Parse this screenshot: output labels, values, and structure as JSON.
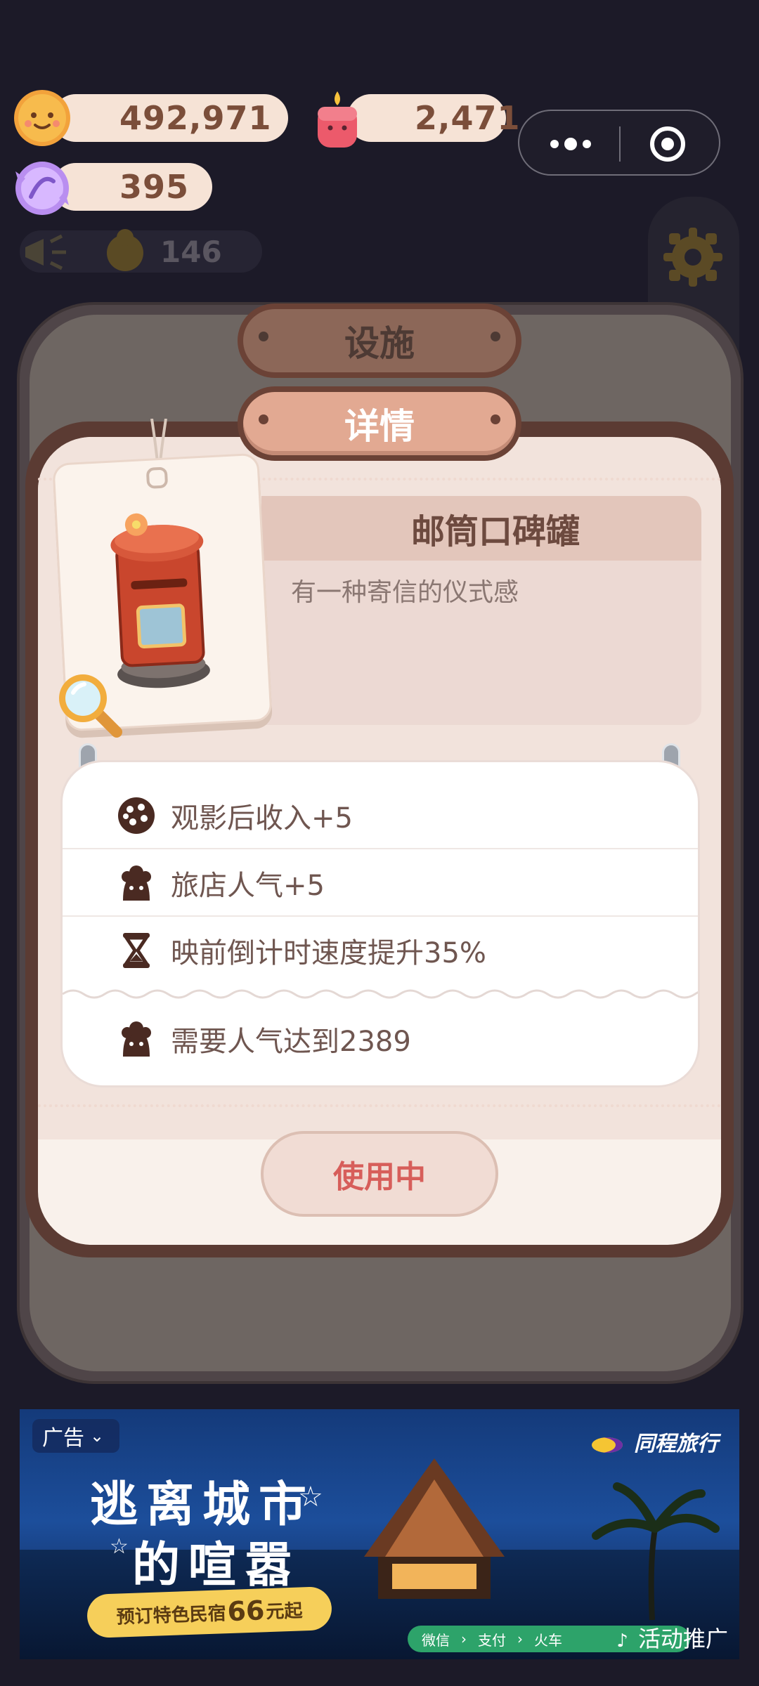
{
  "resources": {
    "cookies": "492,971",
    "candles": "2,471",
    "candy": "395",
    "secondary_count": "146"
  },
  "panel": {
    "facilities_title": "设施",
    "details_title": "详情"
  },
  "item": {
    "name": "邮筒口碑罐",
    "description": "有一种寄信的仪式感"
  },
  "stats": [
    {
      "icon": "cookie-icon",
      "text": "观影后收入+5"
    },
    {
      "icon": "fan-icon",
      "text": "旅店人气+5"
    },
    {
      "icon": "hourglass-icon",
      "text": "映前倒计时速度提升35%"
    }
  ],
  "requirement": {
    "icon": "fan-icon",
    "text": "需要人气达到2389"
  },
  "action": {
    "button_label": "使用中"
  },
  "ad": {
    "badge": "广告",
    "brand": "同程旅行",
    "title_line1": "逃离城市",
    "title_line2": "的喧嚣",
    "promo_prefix": "预订特色民宿",
    "promo_number": "66",
    "promo_suffix": "元起",
    "pay_options": [
      "微信",
      "支付",
      "火车"
    ],
    "cta": "活动推广"
  },
  "colors": {
    "background": "#1c1a28",
    "pill": "#f6e3d6",
    "pill_text": "#7b4e3a",
    "frame_brown": "#5b3b33",
    "button_text": "#d75e5a"
  }
}
